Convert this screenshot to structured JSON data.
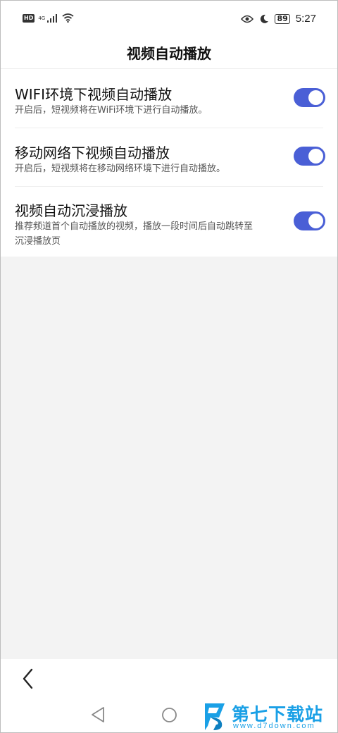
{
  "status_bar": {
    "hd": "HD",
    "network": "4G",
    "time": "5:27",
    "battery": "89",
    "icons": [
      "signal-icon",
      "wifi-icon",
      "eye-icon",
      "moon-icon",
      "battery-icon"
    ]
  },
  "header": {
    "title": "视频自动播放"
  },
  "settings": [
    {
      "title": "WIFI环境下视频自动播放",
      "description": "开启后，短视频将在WiFi环境下进行自动播放。",
      "enabled": true
    },
    {
      "title": "移动网络下视频自动播放",
      "description": "开启后，短视频将在移动网络环境下进行自动播放。",
      "enabled": true
    },
    {
      "title": "视频自动沉浸播放",
      "description": "推荐频道首个自动播放的视频，播放一段时间后自动跳转至沉浸播放页",
      "enabled": true
    }
  ],
  "colors": {
    "toggle_on": "#4a5fd6",
    "background": "#f3f3f3",
    "watermark": "#1aa0e6"
  },
  "watermark": {
    "name": "第七下载站",
    "url": "www.d7down.com"
  }
}
